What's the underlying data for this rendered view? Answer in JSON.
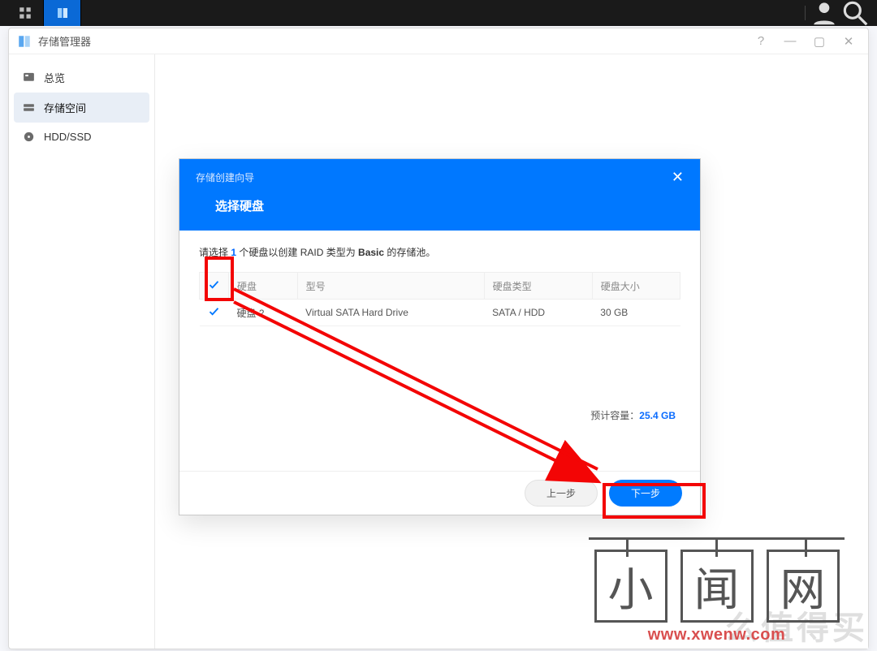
{
  "taskbar": {},
  "window": {
    "title": "存储管理器",
    "actions": {
      "help": "?",
      "min": "—",
      "max": "▢",
      "close": "✕"
    }
  },
  "sidebar": {
    "items": [
      {
        "id": "overview",
        "label": "总览"
      },
      {
        "id": "storage",
        "label": "存储空间"
      },
      {
        "id": "hdd",
        "label": "HDD/SSD"
      }
    ],
    "activeIndex": 1
  },
  "wizard": {
    "breadcrumb": "存储创建向导",
    "title": "选择硬盘",
    "instruction_pre": "请选择 ",
    "instruction_num": "1",
    "instruction_mid": " 个硬盘以创建 RAID 类型为 ",
    "instruction_bold": "Basic",
    "instruction_post": " 的存储池。",
    "columns": {
      "drive": "硬盘",
      "model": "型号",
      "type": "硬盘类型",
      "size": "硬盘大小"
    },
    "rows": [
      {
        "checked": true,
        "drive": "硬盘 2",
        "model": "Virtual SATA Hard Drive",
        "type": "SATA / HDD",
        "size": "30 GB"
      }
    ],
    "estimate_label": "预计容量：",
    "estimate_value": "25.4 GB",
    "btn_prev": "上一步",
    "btn_next": "下一步"
  },
  "watermark": {
    "chars": [
      "小",
      "闻",
      "网"
    ],
    "url": "www.xwenw.com",
    "faint": "么值得买"
  }
}
